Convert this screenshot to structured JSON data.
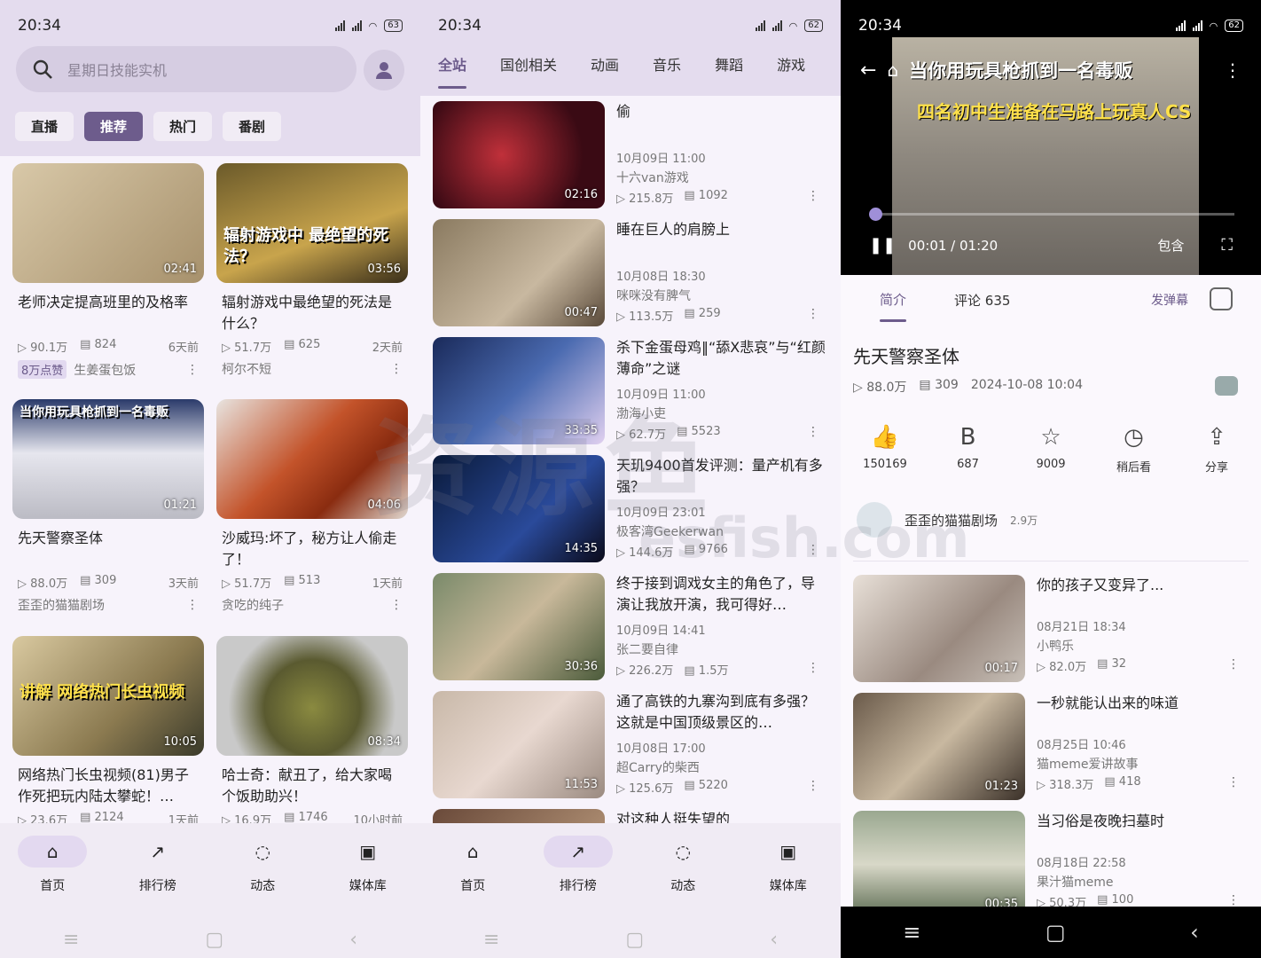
{
  "status": {
    "time": "20:34",
    "battery_left": "63",
    "battery_mid": "62",
    "battery_right": "62"
  },
  "home": {
    "search_placeholder": "星期日技能实机",
    "chips": [
      "直播",
      "推荐",
      "热门",
      "番剧"
    ],
    "cards": [
      {
        "title": "老师决定提高班里的及格率",
        "views": "90.1万",
        "danmaku": "824",
        "date": "6天前",
        "tag": "8万点赞",
        "author": "生姜蛋包饭",
        "duration": "02:41",
        "caption": ""
      },
      {
        "title": "辐射游戏中最绝望的死法是什么？",
        "views": "51.7万",
        "danmaku": "625",
        "date": "2天前",
        "tag": "",
        "author": "柯尔不短",
        "duration": "03:56",
        "caption": "辐射游戏中 最绝望的死法？"
      },
      {
        "title": "先天警察圣体",
        "views": "88.0万",
        "danmaku": "309",
        "date": "3天前",
        "tag": "",
        "author": "歪歪的猫猫剧场",
        "duration": "01:21",
        "caption": "当你用玩具枪抓到一名毒贩"
      },
      {
        "title": "沙威玛:坏了，秘方让人偷走了！",
        "views": "51.7万",
        "danmaku": "513",
        "date": "1天前",
        "tag": "",
        "author": "贪吃的纯子",
        "duration": "04:06",
        "caption": ""
      },
      {
        "title": "网络热门长虫视频(81)男子作死把玩内陆太攀蛇！…",
        "views": "23.6万",
        "danmaku": "2124",
        "date": "1天前",
        "tag": "",
        "author": "",
        "duration": "10:05",
        "caption": "讲解 网络热门长虫视频"
      },
      {
        "title": "哈士奇：献丑了，给大家喝个饭助助兴！",
        "views": "16.9万",
        "danmaku": "1746",
        "date": "10小时前",
        "tag": "",
        "author": "",
        "duration": "08:34",
        "caption": ""
      }
    ],
    "nav": [
      "首页",
      "排行榜",
      "动态",
      "媒体库"
    ]
  },
  "ranking": {
    "tabs": [
      "全站",
      "国创相关",
      "动画",
      "音乐",
      "舞蹈",
      "游戏"
    ],
    "rows": [
      {
        "title": "偷",
        "time": "10月09日 11:00",
        "author": "十六van游戏",
        "views": "215.8万",
        "danmaku": "1092",
        "duration": "02:16"
      },
      {
        "title": "睡在巨人的肩膀上",
        "time": "10月08日 18:30",
        "author": "咪咪没有脾气",
        "views": "113.5万",
        "danmaku": "259",
        "duration": "00:47"
      },
      {
        "title": "杀下金蛋母鸡‖“舔X悲哀”与“红颜薄命”之谜",
        "time": "10月09日 11:00",
        "author": "渤海小吏",
        "views": "62.7万",
        "danmaku": "5523",
        "duration": "33:35"
      },
      {
        "title": "天玑9400首发评测：量产机有多强？",
        "time": "10月09日 23:01",
        "author": "极客湾Geekerwan",
        "views": "144.6万",
        "danmaku": "9766",
        "duration": "14:35"
      },
      {
        "title": "终于接到调戏女主的角色了，导演让我放开演，我可得好…",
        "time": "10月09日 14:41",
        "author": "张二要自律",
        "views": "226.2万",
        "danmaku": "1.5万",
        "duration": "30:36"
      },
      {
        "title": "通了高铁的九寨沟到底有多强？这就是中国顶级景区的…",
        "time": "10月08日 17:00",
        "author": "超Carry的柴西",
        "views": "125.6万",
        "danmaku": "5220",
        "duration": "11:53"
      },
      {
        "title": "对这种人挺失望的",
        "time": "",
        "author": "",
        "views": "",
        "danmaku": "",
        "duration": ""
      }
    ],
    "nav": [
      "首页",
      "排行榜",
      "动态",
      "媒体库"
    ]
  },
  "player": {
    "video_title": "当你用玩具枪抓到一名毒贩",
    "subtitle": "四名初中生准备在马路上玩真人CS",
    "time": "00:01 / 01:20",
    "progress": 0.012,
    "contain": "包含",
    "tabs": {
      "intro": "简介",
      "comments": "评论 635",
      "danmaku": "发弹幕"
    },
    "title": "先天警察圣体",
    "views": "88.0万",
    "danmaku_count": "309",
    "published": "2024-10-08 10:04",
    "actions": [
      {
        "icon": "👍",
        "label": "150169"
      },
      {
        "icon": "B",
        "label": "687"
      },
      {
        "icon": "☆",
        "label": "9009"
      },
      {
        "icon": "◷",
        "label": "稍后看"
      },
      {
        "icon": "⇪",
        "label": "分享"
      }
    ],
    "uploader": {
      "name": "歪歪的猫猫剧场",
      "fans": "2.9万"
    },
    "related": [
      {
        "title": "你的孩子又变异了...",
        "time": "08月21日 18:34",
        "author": "小鸭乐",
        "views": "82.0万",
        "danmaku": "32",
        "duration": "00:17"
      },
      {
        "title": "一秒就能认出来的味道",
        "time": "08月25日 10:46",
        "author": "猫meme爱讲故事",
        "views": "318.3万",
        "danmaku": "418",
        "duration": "01:23"
      },
      {
        "title": "当习俗是夜晚扫墓时",
        "time": "08月18日 22:58",
        "author": "果汁猫meme",
        "views": "50.3万",
        "danmaku": "100",
        "duration": "00:35"
      }
    ]
  },
  "watermark": {
    "main": "资源鱼",
    "sub": "esfish.com"
  }
}
